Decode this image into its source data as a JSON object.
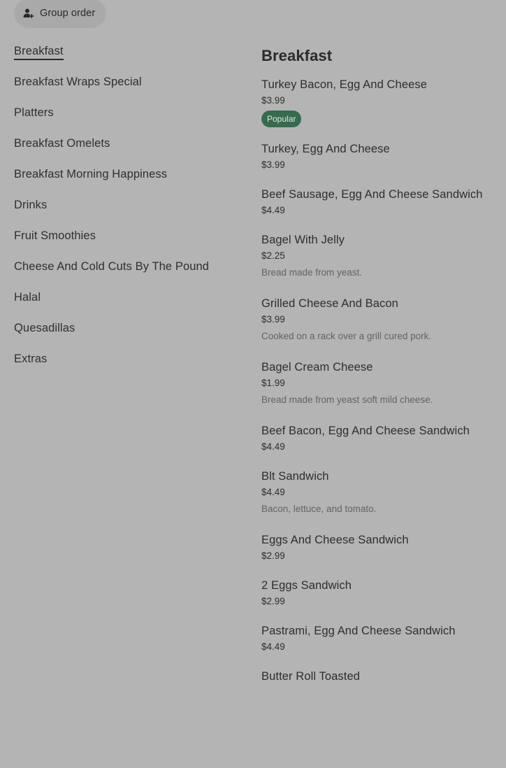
{
  "group_order": {
    "label": "Group order",
    "icon": "person-add-icon"
  },
  "sidebar": {
    "items": [
      {
        "label": "Breakfast",
        "active": true
      },
      {
        "label": "Breakfast Wraps Special"
      },
      {
        "label": "Platters"
      },
      {
        "label": "Breakfast Omelets"
      },
      {
        "label": "Breakfast Morning Happiness"
      },
      {
        "label": "Drinks"
      },
      {
        "label": "Fruit Smoothies"
      },
      {
        "label": "Cheese And Cold Cuts By The Pound"
      },
      {
        "label": "Halal"
      },
      {
        "label": "Quesadillas"
      },
      {
        "label": "Extras"
      }
    ]
  },
  "section": {
    "title": "Breakfast",
    "items": [
      {
        "name": "Turkey Bacon, Egg And Cheese",
        "price": "$3.99",
        "badge": "Popular"
      },
      {
        "name": "Turkey, Egg And Cheese",
        "price": "$3.99"
      },
      {
        "name": "Beef Sausage, Egg And Cheese Sandwich",
        "price": "$4.49"
      },
      {
        "name": "Bagel With Jelly",
        "price": "$2.25",
        "description": "Bread made from yeast."
      },
      {
        "name": "Grilled Cheese And Bacon",
        "price": "$3.99",
        "description": "Cooked on a rack over a grill cured pork."
      },
      {
        "name": "Bagel Cream Cheese",
        "price": "$1.99",
        "description": "Bread made from yeast soft mild cheese."
      },
      {
        "name": "Beef Bacon, Egg And Cheese Sandwich",
        "price": "$4.49"
      },
      {
        "name": "Blt Sandwich",
        "price": "$4.49",
        "description": "Bacon, lettuce, and tomato."
      },
      {
        "name": "Eggs And Cheese Sandwich",
        "price": "$2.99"
      },
      {
        "name": "2 Eggs Sandwich",
        "price": "$2.99"
      },
      {
        "name": "Pastrami, Egg And Cheese Sandwich",
        "price": "$4.49"
      },
      {
        "name": "Butter Roll Toasted",
        "price": ""
      }
    ]
  },
  "colors": {
    "background": "#b4b4b4",
    "badge_bg": "#366b4f",
    "text": "#2b2b2b",
    "muted": "#636363"
  }
}
